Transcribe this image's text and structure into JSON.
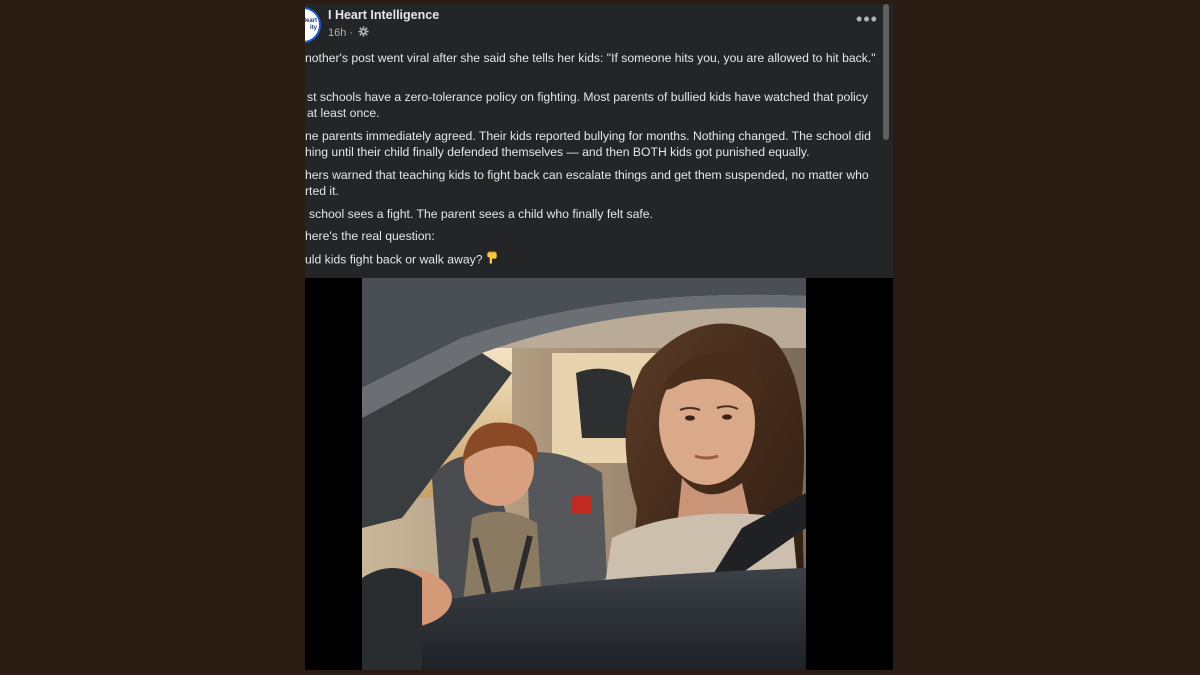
{
  "post": {
    "author": "I Heart Intelligence",
    "time": "16h",
    "audience_icon": "gear-icon",
    "avatar_text": "Heart\nity",
    "more_icon": "more-options-icon",
    "more_label": "•••",
    "paragraphs": [
      "nother's post went viral after she said she tells her kids: \"If someone hits you, you are allowed to hit back.\"",
      "st schools have a zero-tolerance policy on fighting. Most parents of bullied kids have watched that policy\nat least once.",
      "ne parents immediately agreed. Their kids reported bullying for months. Nothing changed. The school did\nhing until their child finally defended themselves — and then BOTH kids got punished equally.",
      "hers warned that teaching kids to fight back can escalate things and get them suspended, no matter who\nrted it.",
      "school sees a fight. The parent sees a child who finally felt safe.",
      "here's the real question:",
      "uld kids fight back or walk away?"
    ],
    "last_icon": "pointing-down-hand-icon"
  },
  "colors": {
    "page_bg": "#2a1c12",
    "card_bg": "#242526",
    "text": "#e4e6eb",
    "secondary_text": "#b0b3b8",
    "brand_blue": "#1d5fd1"
  }
}
